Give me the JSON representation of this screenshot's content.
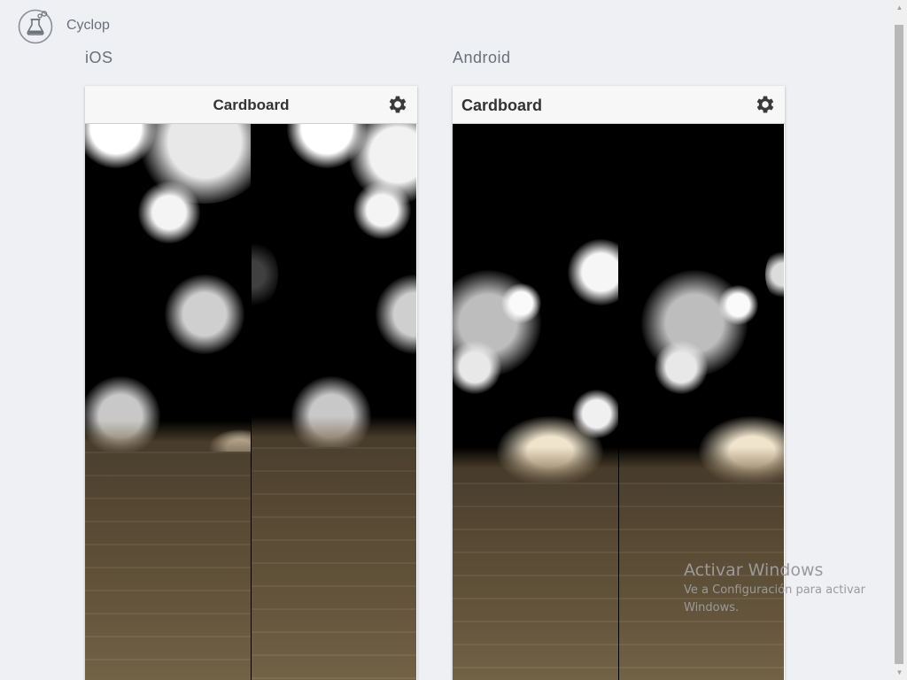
{
  "app": {
    "title": "Cyclop",
    "logo_icon": "flask-icon"
  },
  "columns": [
    {
      "platform": "iOS",
      "toolbar_title": "Cardboard",
      "settings_icon": "gear-icon"
    },
    {
      "platform": "Android",
      "toolbar_title": "Cardboard",
      "settings_icon": "gear-icon"
    }
  ],
  "watermark": {
    "title": "Activar Windows",
    "subtitle": "Ve a Configuración para activar Windows."
  },
  "colors": {
    "background": "#eef0f4",
    "toolbar": "#f7f7f7",
    "floor": "#5e4f37"
  }
}
